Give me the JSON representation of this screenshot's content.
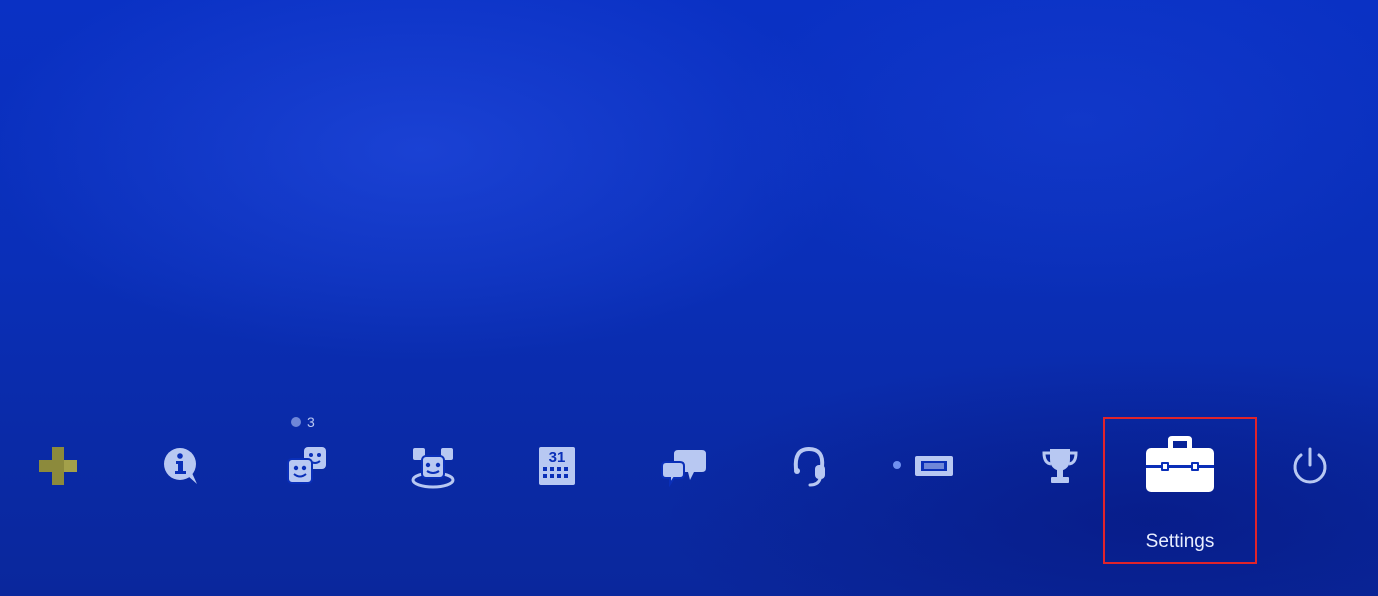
{
  "function_area": {
    "items": [
      {
        "id": "playstation-plus",
        "icon": "playstation-plus-icon"
      },
      {
        "id": "whats-new",
        "icon": "info-icon"
      },
      {
        "id": "friends",
        "icon": "friends-icon",
        "badge": "3"
      },
      {
        "id": "party",
        "icon": "party-icon"
      },
      {
        "id": "events",
        "icon": "calendar-icon",
        "calendar_day": "31"
      },
      {
        "id": "messages",
        "icon": "messages-icon"
      },
      {
        "id": "notifications",
        "icon": "headset-icon"
      },
      {
        "id": "live",
        "icon": "live-broadcast-icon"
      },
      {
        "id": "trophies",
        "icon": "trophy-icon"
      },
      {
        "id": "settings",
        "icon": "toolbox-icon",
        "label": "Settings",
        "selected": true
      },
      {
        "id": "power",
        "icon": "power-icon"
      }
    ]
  },
  "colors": {
    "background": "#0a2fb8",
    "icon": "#b8c8f2",
    "selected_icon": "#ffffff",
    "plus_accent": "#8c8a3c",
    "highlight_frame": "#e0242b"
  }
}
